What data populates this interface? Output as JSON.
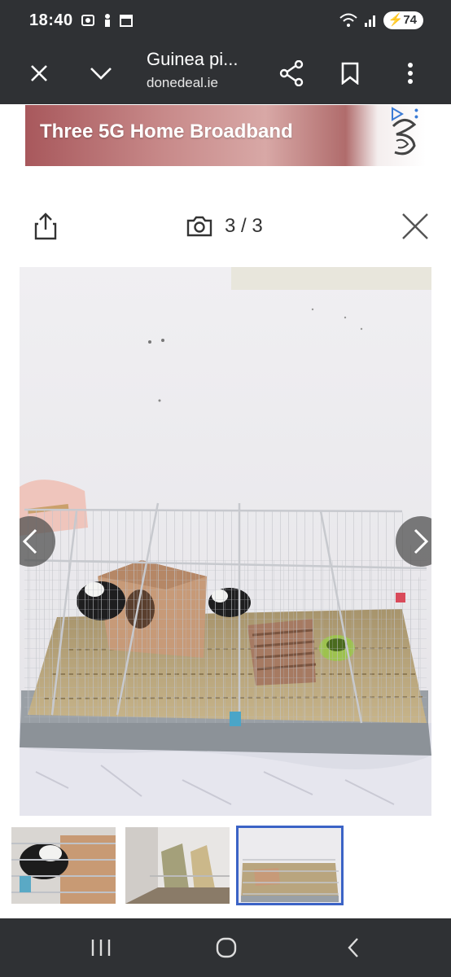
{
  "status": {
    "time": "18:40",
    "battery": "74",
    "notif_icons": [
      "media-icon",
      "person-icon",
      "calendar-icon"
    ]
  },
  "toolbar": {
    "title": "Guinea pi...",
    "domain": "donedeal.ie"
  },
  "ad": {
    "text": "Three 5G Home Broadband",
    "brand_color": "#a8585c"
  },
  "viewer": {
    "counter": "3 / 3"
  },
  "thumbnails": [
    {
      "label": "guinea pig in house",
      "active": false
    },
    {
      "label": "bags of hay",
      "active": false
    },
    {
      "label": "cage overview",
      "active": true
    }
  ],
  "colors": {
    "bar_bg": "#2f3134",
    "accent": "#3b63c6"
  }
}
